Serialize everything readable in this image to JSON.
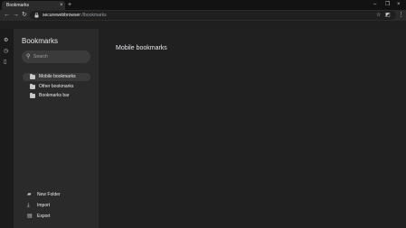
{
  "tab": {
    "title": "Bookmarks",
    "close_glyph": "×",
    "new_tab_glyph": "+"
  },
  "window": {
    "minimize": "–",
    "maximize": "❐",
    "close": "×"
  },
  "toolbar": {
    "back": "←",
    "forward": "→",
    "reload": "↻",
    "url_host": "securewebbrowser",
    "url_path": "://bookmarks",
    "site_icon": "lock-icon",
    "star_glyph": "☆",
    "extension_glyph": "◩",
    "menu_glyph": "⋮"
  },
  "rail": {
    "items": [
      {
        "name": "settings-icon",
        "glyph": "⚙"
      },
      {
        "name": "history-icon",
        "glyph": "◷"
      },
      {
        "name": "bookmarks-icon",
        "glyph": "▯"
      }
    ]
  },
  "sidebar": {
    "title": "Bookmarks",
    "search_placeholder": "Search",
    "folders": [
      {
        "label": "Mobile bookmarks",
        "selected": true
      },
      {
        "label": "Other bookmarks",
        "selected": false
      },
      {
        "label": "Bookmarks bar",
        "selected": false
      }
    ],
    "actions": [
      {
        "label": "New Folder",
        "icon": "new-folder-icon",
        "glyph": "▰"
      },
      {
        "label": "Import",
        "icon": "import-icon",
        "glyph": "⤓"
      },
      {
        "label": "Export",
        "icon": "export-icon",
        "glyph": "▤"
      }
    ]
  },
  "main": {
    "title": "Mobile bookmarks"
  }
}
